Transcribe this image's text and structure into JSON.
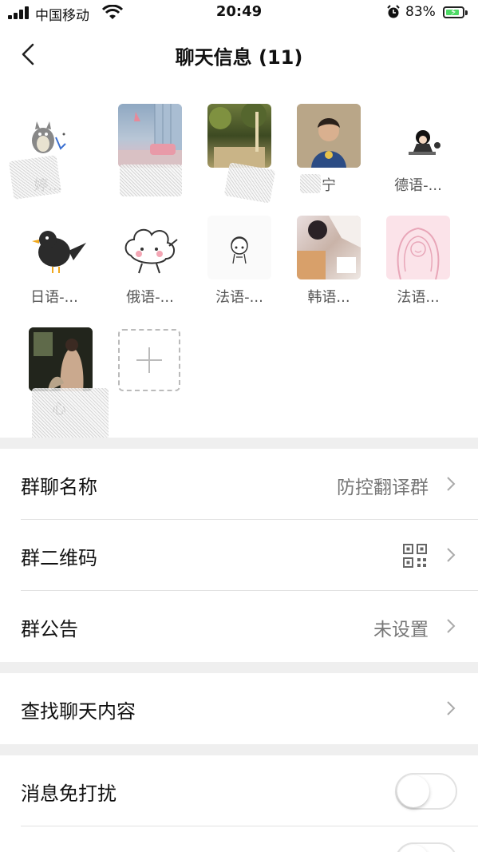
{
  "status_bar": {
    "carrier": "中国移动",
    "time": "20:49",
    "battery": "83%",
    "battery_level": 0.83
  },
  "nav": {
    "back_icon": "chevron-left-icon",
    "title": "聊天信息 (11)"
  },
  "members": [
    {
      "name": "婷..."
    },
    {
      "name": ""
    },
    {
      "name": ""
    },
    {
      "name": "宁"
    },
    {
      "name": "德语-..."
    },
    {
      "name": "日语-..."
    },
    {
      "name": "俄语-..."
    },
    {
      "name": "法语-..."
    },
    {
      "name": "韩语..."
    },
    {
      "name": "法语..."
    },
    {
      "name": "心"
    }
  ],
  "settings": {
    "group_name": {
      "label": "群聊名称",
      "value": "防控翻译群"
    },
    "group_qr": {
      "label": "群二维码",
      "icon": "qr-code-icon"
    },
    "announcement": {
      "label": "群公告",
      "value": "未设置"
    },
    "search": {
      "label": "查找聊天内容"
    },
    "mute": {
      "label": "消息免打扰",
      "enabled": false
    },
    "next": {
      "enabled": false
    }
  },
  "colors": {
    "battery_fill": "#4cd964",
    "gap_bg": "#efefef",
    "secondary_text": "#777777"
  }
}
